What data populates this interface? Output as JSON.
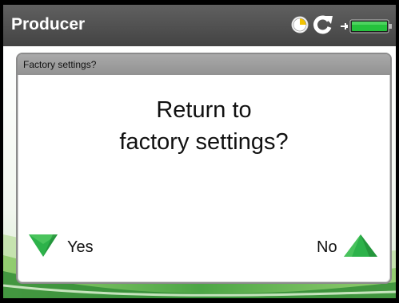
{
  "app": {
    "title": "Producer"
  },
  "status_icons": [
    "clock-icon",
    "refresh-icon",
    "battery-icon"
  ],
  "battery_level": 1.0,
  "colors": {
    "status_bar": "#4f4f4f",
    "dialog_titlebar": "#9e9e9e",
    "accent_green": "#2db24a",
    "battery_green": "#25c23c"
  },
  "dialog": {
    "title": "Factory settings?",
    "message_line1": "Return to",
    "message_line2": "factory settings?",
    "yes_label": "Yes",
    "no_label": "No"
  }
}
